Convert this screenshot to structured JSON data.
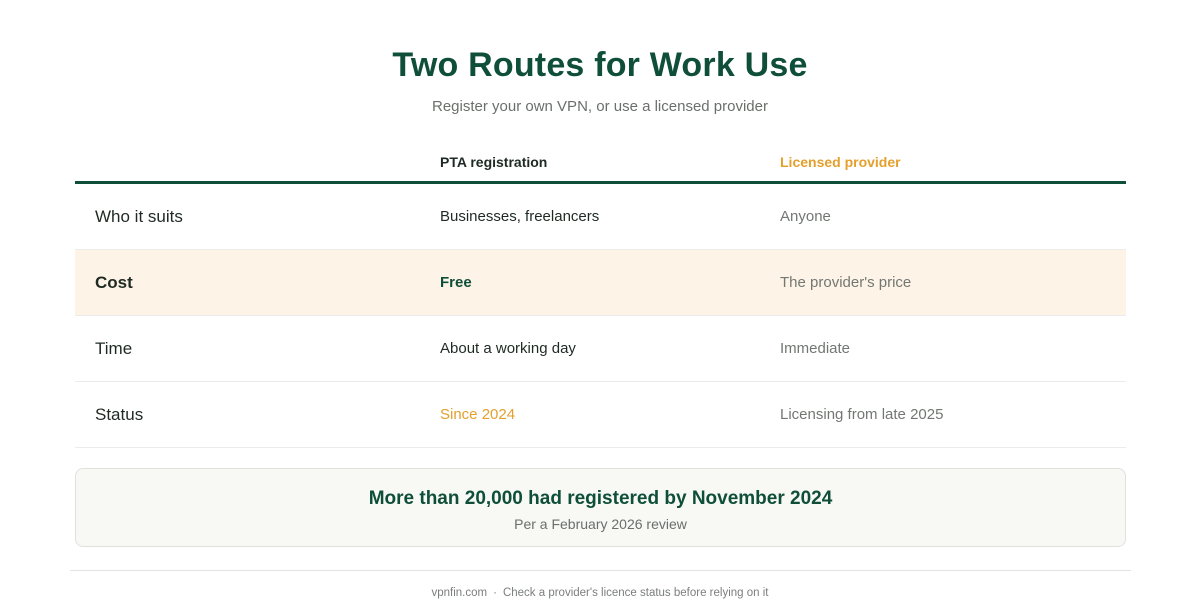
{
  "header": {
    "title": "Two Routes for Work Use",
    "subtitle": "Register your own VPN, or use a licensed provider"
  },
  "table": {
    "columns": [
      "",
      "PTA registration",
      "Licensed provider"
    ],
    "rows": [
      {
        "label": "Who it suits",
        "pta": "Businesses, freelancers",
        "provider": "Anyone"
      },
      {
        "label": "Cost",
        "pta": "Free",
        "provider": "The provider's price"
      },
      {
        "label": "Time",
        "pta": "About a working day",
        "provider": "Immediate"
      },
      {
        "label": "Status",
        "pta": "Since 2024",
        "provider": "Licensing from late 2025"
      }
    ]
  },
  "note": {
    "headline": "More than 20,000 had registered by November 2024",
    "source": "Per a February 2026 review"
  },
  "footer": {
    "site": "vpnfin.com",
    "separator": "·",
    "disclaimer": "Check a provider's licence status before relying on it"
  },
  "colors": {
    "primary_green": "#0f4f3a",
    "accent_amber": "#e3a02c",
    "highlight_row": "#fdf4e7",
    "note_background": "#f8f8f5"
  }
}
